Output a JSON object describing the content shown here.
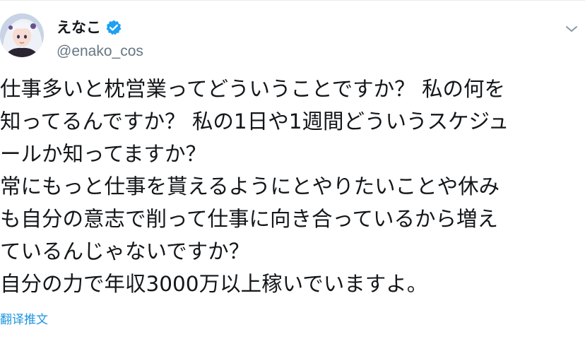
{
  "user": {
    "display_name": "えなこ",
    "handle": "@enako_cos",
    "verified": true
  },
  "icons": {
    "avatar": "avatar-image",
    "verified": "verified-badge-icon",
    "menu": "chevron-down-icon"
  },
  "colors": {
    "verified_blue": "#1da1f2",
    "link_blue": "#1b95e0",
    "handle_gray": "#657786",
    "text": "#14171a"
  },
  "tweet": {
    "lines": [
      "仕事多いと枕営業ってどういうことですか？ 私の何を",
      "知ってるんですか？ 私の1日や1週間どういうスケジュ",
      "ールか知ってますか？",
      "常にもっと仕事を貰えるようにとやりたいことや休み",
      "も自分の意志で削って仕事に向き合っているから増え",
      "ているんじゃないですか？",
      "自分の力で年収3000万以上稼いでいますよ。"
    ]
  },
  "actions": {
    "translate_label": "翻译推文"
  }
}
